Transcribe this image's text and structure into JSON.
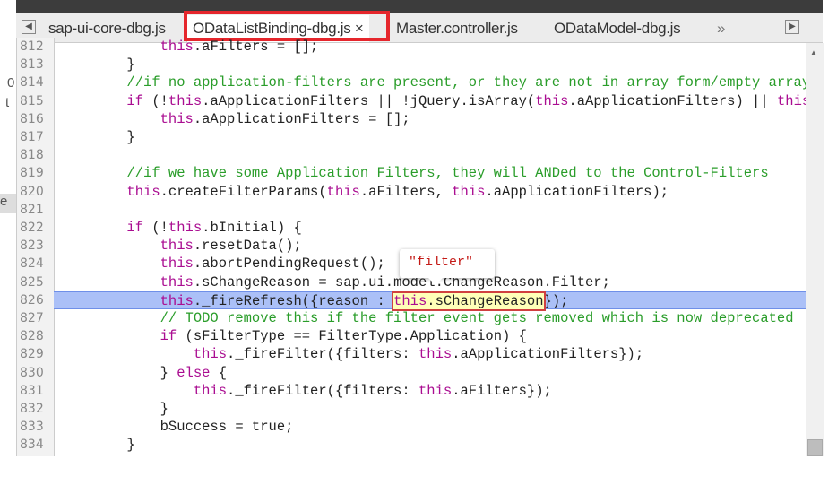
{
  "tabs": [
    {
      "label": "sap-ui-core-dbg.js"
    },
    {
      "label": "ODataListBinding-dbg.js",
      "close": "×"
    },
    {
      "label": "Master.controller.js"
    },
    {
      "label": "ODataModel-dbg.js"
    }
  ],
  "overflow": "»",
  "left_fragments": [
    "0",
    "t",
    "e"
  ],
  "tooltip": "\"filter\"",
  "highlight_color": "#e5262c",
  "lines": [
    {
      "n": "812",
      "t": [
        [
          "kw",
          "            this"
        ],
        [
          "",
          "."
        ],
        [
          "",
          "aFilters = [];"
        ]
      ]
    },
    {
      "n": "813",
      "t": [
        [
          "",
          "        }"
        ]
      ]
    },
    {
      "n": "814",
      "t": [
        [
          "cm",
          "        //if no application-filters are present, or they are not in array form/empty array"
        ]
      ]
    },
    {
      "n": "815",
      "t": [
        [
          "kw",
          "        if"
        ],
        [
          "",
          " (!"
        ],
        [
          "kw",
          "this"
        ],
        [
          "",
          ".aApplicationFilters || !jQuery.isArray("
        ],
        [
          "kw",
          "this"
        ],
        [
          "",
          ".aApplicationFilters) || "
        ],
        [
          "kw",
          "this"
        ]
      ]
    },
    {
      "n": "816",
      "t": [
        [
          "kw",
          "            this"
        ],
        [
          "",
          ".aApplicationFilters = [];"
        ]
      ]
    },
    {
      "n": "817",
      "t": [
        [
          "",
          "        }"
        ]
      ]
    },
    {
      "n": "818",
      "t": []
    },
    {
      "n": "819",
      "t": [
        [
          "cm",
          "        //if we have some Application Filters, they will ANDed to the Control-Filters"
        ]
      ]
    },
    {
      "n": "820",
      "t": [
        [
          "kw",
          "        this"
        ],
        [
          "",
          ".createFilterParams("
        ],
        [
          "kw",
          "this"
        ],
        [
          "",
          ".aFilters, "
        ],
        [
          "kw",
          "this"
        ],
        [
          "",
          ".aApplicationFilters);"
        ]
      ]
    },
    {
      "n": "821",
      "t": []
    },
    {
      "n": "822",
      "t": [
        [
          "kw",
          "        if"
        ],
        [
          "",
          " (!"
        ],
        [
          "kw",
          "this"
        ],
        [
          "",
          ".bInitial) {"
        ]
      ]
    },
    {
      "n": "823",
      "t": [
        [
          "kw",
          "            this"
        ],
        [
          "",
          ".resetData();"
        ]
      ]
    },
    {
      "n": "824",
      "t": [
        [
          "kw",
          "            this"
        ],
        [
          "",
          ".abortPendingRequest();"
        ]
      ]
    },
    {
      "n": "825",
      "t": [
        [
          "kw",
          "            this"
        ],
        [
          "",
          ".sChangeReason = sap.ui.model.ChangeReason.Filter;"
        ]
      ]
    },
    {
      "n": "826",
      "exec": true,
      "t": [
        [
          "kw",
          "            this"
        ],
        [
          "",
          "._fireRefresh({reason : "
        ],
        [
          "hover",
          "this.sChangeReason"
        ],
        [
          "",
          "});"
        ]
      ]
    },
    {
      "n": "827",
      "t": [
        [
          "cm",
          "            // TODO remove this if the filter event gets removed which is now deprecated"
        ]
      ]
    },
    {
      "n": "828",
      "t": [
        [
          "kw",
          "            if"
        ],
        [
          "",
          " (sFilterType == FilterType.Application) {"
        ]
      ]
    },
    {
      "n": "829",
      "t": [
        [
          "kw",
          "                this"
        ],
        [
          "",
          "._fireFilter({filters: "
        ],
        [
          "kw",
          "this"
        ],
        [
          "",
          ".aApplicationFilters});"
        ]
      ]
    },
    {
      "n": "830",
      "t": [
        [
          "",
          "            } "
        ],
        [
          "kw",
          "else"
        ],
        [
          "",
          " {"
        ]
      ]
    },
    {
      "n": "831",
      "t": [
        [
          "kw",
          "                this"
        ],
        [
          "",
          "._fireFilter({filters: "
        ],
        [
          "kw",
          "this"
        ],
        [
          "",
          ".aFilters});"
        ]
      ]
    },
    {
      "n": "832",
      "t": [
        [
          "",
          "            }"
        ]
      ]
    },
    {
      "n": "833",
      "t": [
        [
          "",
          "            bSuccess = true;"
        ]
      ]
    },
    {
      "n": "834",
      "t": [
        [
          "",
          "        }"
        ]
      ]
    }
  ]
}
